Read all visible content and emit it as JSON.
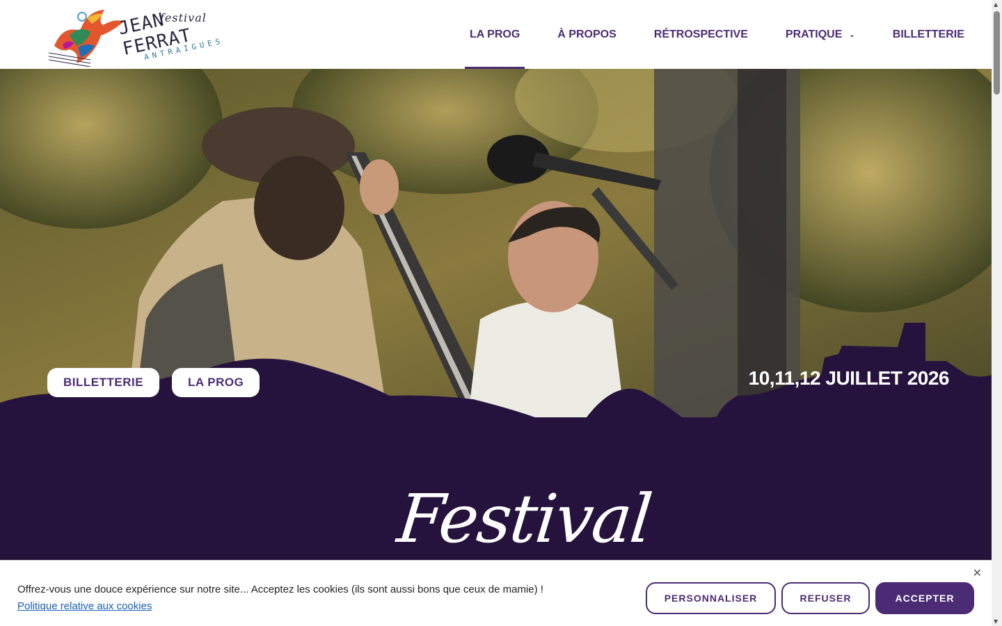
{
  "header": {
    "logo": {
      "line1": "festival",
      "line2": "JEAN FERRAT",
      "line3": "ANTRAIGUES"
    },
    "nav": [
      {
        "label": "LA PROG",
        "active": true
      },
      {
        "label": "À PROPOS",
        "active": false
      },
      {
        "label": "RÉTROSPECTIVE",
        "active": false
      },
      {
        "label": "PRATIQUE",
        "active": false,
        "has_dropdown": true
      },
      {
        "label": "BILLETTERIE",
        "active": false
      }
    ]
  },
  "hero": {
    "buttons": {
      "billetterie": "BILLETTERIE",
      "prog": "LA PROG"
    },
    "dates": "10,11,12 JUILLET 2026"
  },
  "band": {
    "title": "Festival"
  },
  "cookie": {
    "message": "Offrez-vous une douce expérience sur notre site... Acceptez les cookies (ils sont aussi bons que ceux de mamie) !",
    "policy_link": "Politique relative aux cookies",
    "buttons": {
      "customize": "PERSONNALISER",
      "refuse": "REFUSER",
      "accept": "ACCEPTER"
    }
  },
  "colors": {
    "brand_purple": "#4b2b73",
    "band_dark": "#26133d"
  },
  "icons": {
    "close": "close-icon",
    "dropdown": "chevron-down-icon"
  }
}
